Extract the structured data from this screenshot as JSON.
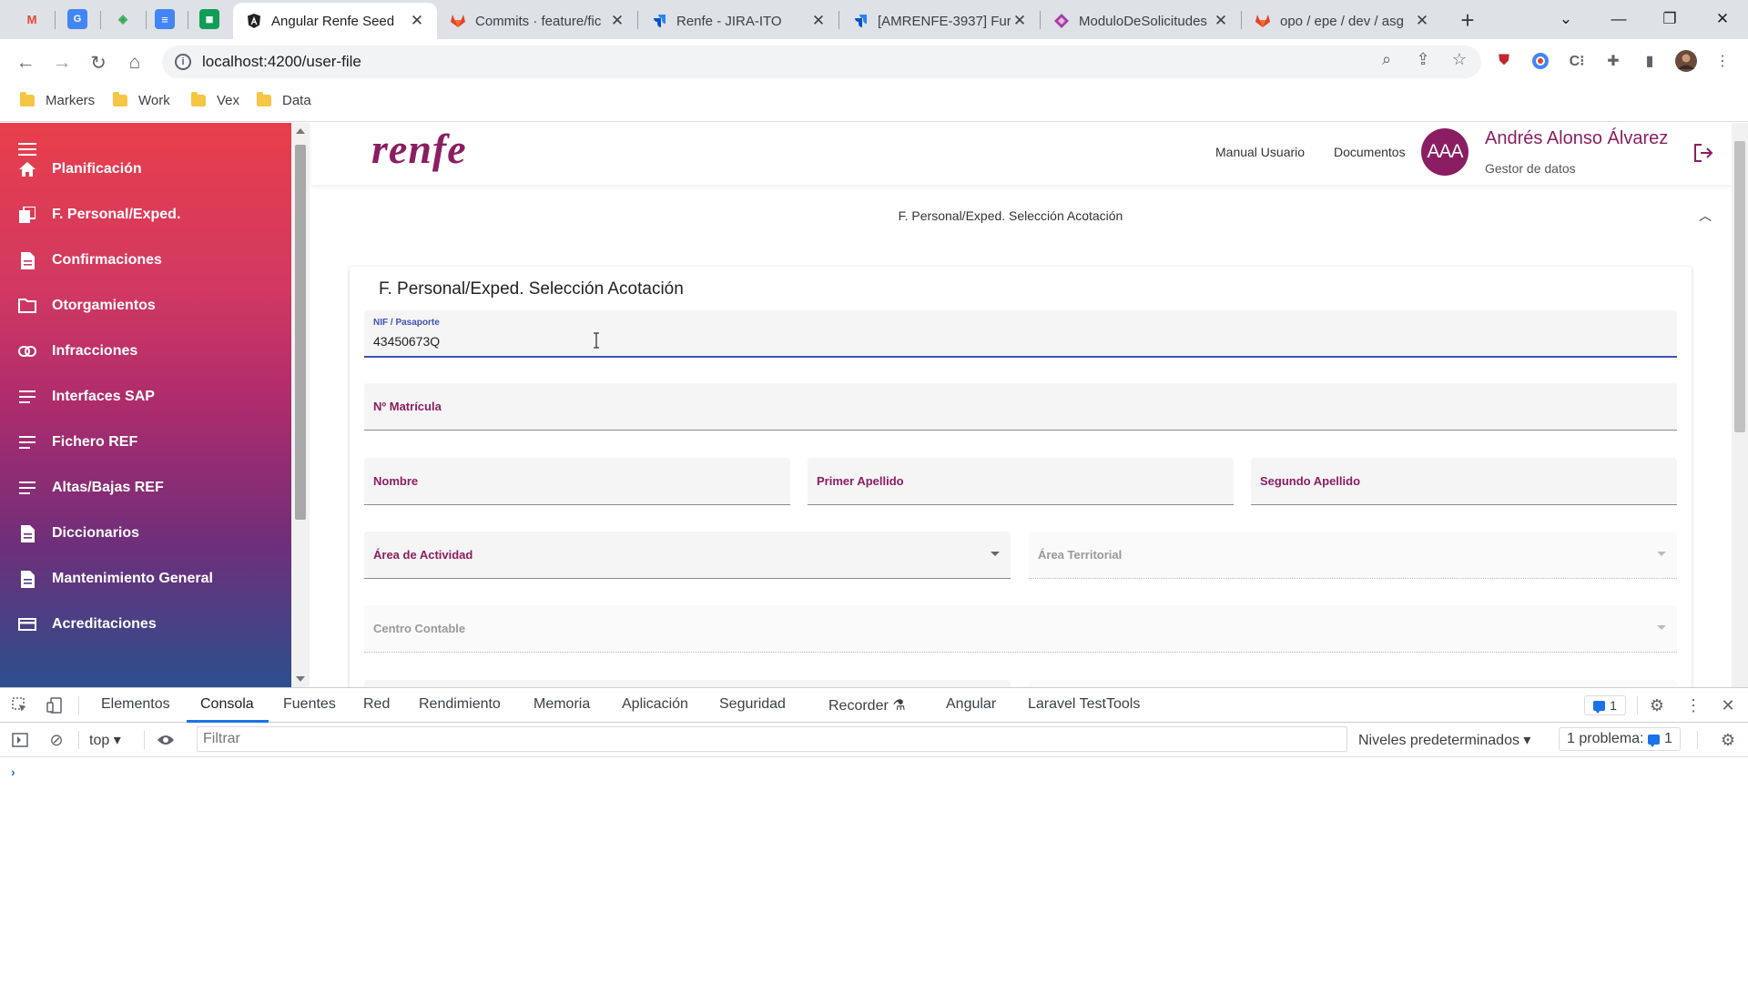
{
  "browser": {
    "pinned_tabs": [
      {
        "icon": "gmail-icon",
        "glyph": "M",
        "color": "#ea4335"
      },
      {
        "icon": "translate-icon",
        "glyph": "G",
        "color": "#4285f4"
      },
      {
        "icon": "recycle-icon",
        "glyph": "◆",
        "color": "#34a853"
      },
      {
        "icon": "docs-icon",
        "glyph": "≡",
        "color": "#4285f4"
      },
      {
        "icon": "keep-icon",
        "glyph": "▦",
        "color": "#0f9d58"
      }
    ],
    "tabs": [
      {
        "title": "Angular Renfe Seed",
        "active": true
      },
      {
        "title": "Commits · feature/fic",
        "active": false
      },
      {
        "title": "Renfe - JIRA-ITO",
        "active": false
      },
      {
        "title": "[AMRENFE-3937] Fur",
        "active": false
      },
      {
        "title": "ModuloDeSolicitudes",
        "active": false
      },
      {
        "title": "opo / epe / dev / asg",
        "active": false
      }
    ],
    "url": "localhost:4200/user-file",
    "bookmarks": [
      "Markers",
      "Work",
      "Vex",
      "Data"
    ]
  },
  "app": {
    "logo": "renfe",
    "header": {
      "manual_link": "Manual Usuario",
      "docs_link": "Documentos",
      "avatar_initials": "AAA",
      "user_name": "Andrés Alonso Álvarez",
      "user_role": "Gestor de datos"
    },
    "sidebar": {
      "items": [
        {
          "label": "Planificación",
          "icon": "home-icon"
        },
        {
          "label": "F. Personal/Exped.",
          "icon": "copy-icon"
        },
        {
          "label": "Confirmaciones",
          "icon": "document-icon"
        },
        {
          "label": "Otorgamientos",
          "icon": "folder-icon"
        },
        {
          "label": "Infracciones",
          "icon": "link-icon"
        },
        {
          "label": "Interfaces SAP",
          "icon": "lines-icon"
        },
        {
          "label": "Fichero REF",
          "icon": "lines-icon"
        },
        {
          "label": "Altas/Bajas REF",
          "icon": "lines-icon"
        },
        {
          "label": "Diccionarios",
          "icon": "document-icon"
        },
        {
          "label": "Mantenimiento General",
          "icon": "document-icon"
        },
        {
          "label": "Acreditaciones",
          "icon": "card-icon"
        }
      ]
    },
    "breadcrumb": "F. Personal/Exped. Selección Acotación",
    "form": {
      "title": "F. Personal/Exped. Selección Acotación",
      "nif_label": "NIF / Pasaporte",
      "nif_value": "43450673Q",
      "matricula_label": "Nº Matrícula",
      "nombre_label": "Nombre",
      "primer_apellido_label": "Primer Apellido",
      "segundo_apellido_label": "Segundo Apellido",
      "area_actividad_label": "Área de Actividad",
      "area_territorial_label": "Área Territorial",
      "centro_contable_label": "Centro Contable"
    }
  },
  "devtools": {
    "tabs": [
      "Elementos",
      "Consola",
      "Fuentes",
      "Red",
      "Rendimiento",
      "Memoria",
      "Aplicación",
      "Seguridad",
      "Recorder",
      "Angular",
      "Laravel TestTools"
    ],
    "active_tab": "Consola",
    "issues_badge": "1",
    "context": "top",
    "filter_placeholder": "Filtrar",
    "levels": "Niveles predeterminados",
    "issues_label": "1 problema:",
    "issues_count": "1",
    "prompt": "›"
  }
}
